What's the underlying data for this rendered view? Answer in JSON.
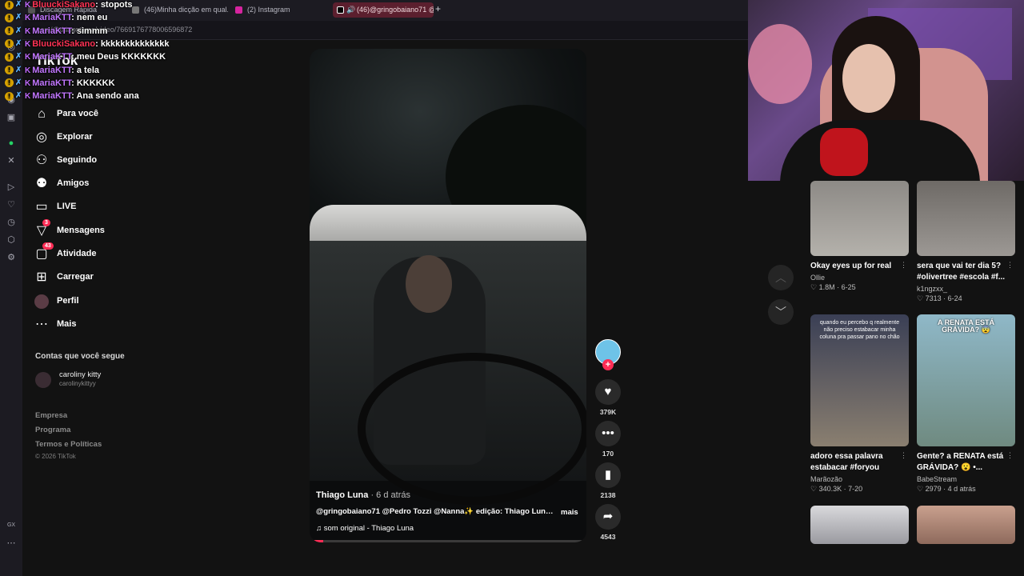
{
  "browser": {
    "tabs": [
      {
        "label": "Discagem Rápida"
      },
      {
        "label": "(46)Minha dicção em qual..."
      },
      {
        "label": "(2) Instagram"
      },
      {
        "label": "(46)@gringobaiano71 @..."
      }
    ],
    "url": "com/@thiagotluna/video/7669176778006596872",
    "sidebar_label": "GX"
  },
  "tiktok": {
    "logo": "TikTok",
    "nav": [
      {
        "label": "Para você",
        "icon": "home-icon"
      },
      {
        "label": "Explorar",
        "icon": "compass-icon"
      },
      {
        "label": "Seguindo",
        "icon": "following-icon"
      },
      {
        "label": "Amigos",
        "icon": "friends-icon"
      },
      {
        "label": "LIVE",
        "icon": "live-icon"
      },
      {
        "label": "Mensagens",
        "icon": "messages-icon",
        "badge": "3"
      },
      {
        "label": "Atividade",
        "icon": "activity-icon",
        "badge": "43"
      },
      {
        "label": "Carregar",
        "icon": "upload-icon"
      },
      {
        "label": "Perfil",
        "icon": "profile-avatar"
      },
      {
        "label": "Mais",
        "icon": "more-icon"
      }
    ],
    "following_title": "Contas que você segue",
    "following": [
      {
        "name": "caroliny kitty",
        "handle": "carolinykittyy"
      }
    ],
    "footer": [
      "Empresa",
      "Programa",
      "Termos e Políticas"
    ],
    "copyright": "© 2026 TikTok"
  },
  "chat": [
    {
      "user": "BluuckiSakano",
      "color": "#ff3355",
      "msg": ": stopots"
    },
    {
      "user": "MariaKTT",
      "color": "#c277ff",
      "msg": ": nem eu"
    },
    {
      "user": "MariaKTT",
      "color": "#c277ff",
      "msg": ": simmm"
    },
    {
      "user": "BluuckiSakano",
      "color": "#ff3355",
      "msg": ": kkkkkkkkkkkkkk"
    },
    {
      "user": "MariaKTT",
      "color": "#c277ff",
      "msg": ": meu Deus KKKKKKK"
    },
    {
      "user": "MariaKTT",
      "color": "#c277ff",
      "msg": ": a tela"
    },
    {
      "user": "MariaKTT",
      "color": "#c277ff",
      "msg": ": KKKKKK"
    },
    {
      "user": "MariaKTT",
      "color": "#c277ff",
      "msg": ": Ana sendo ana"
    }
  ],
  "video": {
    "author": "Thiago Luna",
    "time": " · 6 d atrás",
    "description": "@gringobaiano71 @Pedro Tozzi @Nanna✨ edição: Thiago Luna...",
    "more": "mais",
    "music": "som original - Thiago Luna",
    "progress": 0.05
  },
  "actions": {
    "likes": "379K",
    "comments": "170",
    "saves": "2138",
    "shares": "4543"
  },
  "recommended": [
    {
      "title": "Okay eyes up for real",
      "author": "Ollie",
      "views": "1.8M",
      "date": "6-25",
      "caption": ""
    },
    {
      "title": "sera que vai ter dia 5? #olivertree #escola #f...",
      "author": "k1ngzxx_",
      "views": "7313",
      "date": "6-24",
      "caption": ""
    },
    {
      "title": "adoro essa palavra estabacar #foryou",
      "author": "Marãozão",
      "views": "340.3K",
      "date": "7-20",
      "caption": "quando eu percebo q realmente não preciso estabacar minha coluna pra passar pano no chão"
    },
    {
      "title": "Gente? a RENATA está GRÁVIDA? 😮 •...",
      "author": "BabeStream",
      "views": "2979",
      "date": "4 d atrás",
      "caption": "A RENATA ESTÁ GRÁVIDA? 😨"
    }
  ]
}
